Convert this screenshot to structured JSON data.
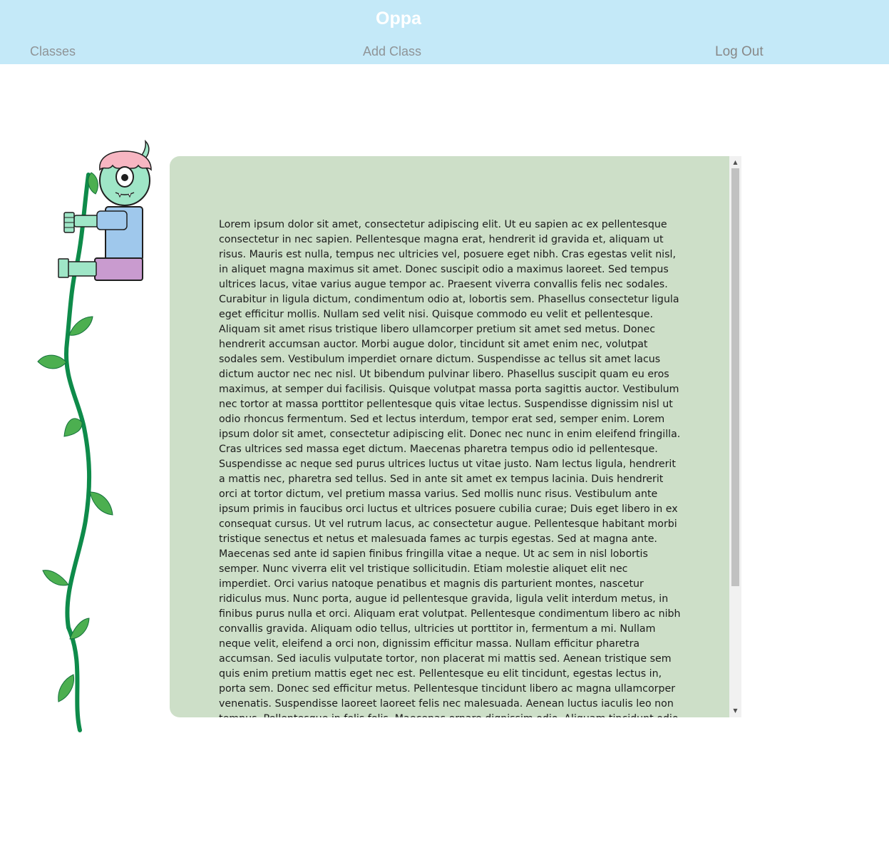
{
  "header": {
    "title": "Oppa",
    "nav": {
      "classes": "Classes",
      "add_class": "Add Class",
      "log_out": "Log Out"
    },
    "background_color": "#c4e9f8"
  },
  "illustration": {
    "icon": "monster-climbing-beanstalk-icon"
  },
  "content": {
    "panel_color": "#cddfc8",
    "body_text": "Lorem ipsum dolor sit amet, consectetur adipiscing elit. Ut eu sapien ac ex pellentesque consectetur in nec sapien. Pellentesque magna erat, hendrerit id gravida et, aliquam ut risus. Mauris est nulla, tempus nec ultricies vel, posuere eget nibh. Cras egestas velit nisl, in aliquet magna maximus sit amet. Donec suscipit odio a maximus laoreet. Sed tempus ultrices lacus, vitae varius augue tempor ac. Praesent viverra convallis felis nec sodales. Curabitur in ligula dictum, condimentum odio at, lobortis sem. Phasellus consectetur ligula eget efficitur mollis. Nullam sed velit nisi. Quisque commodo eu velit et pellentesque. Aliquam sit amet risus tristique libero ullamcorper pretium sit amet sed metus. Donec hendrerit accumsan auctor. Morbi augue dolor, tincidunt sit amet enim nec, volutpat sodales sem. Vestibulum imperdiet ornare dictum. Suspendisse ac tellus sit amet lacus dictum auctor nec nec nisl. Ut bibendum pulvinar libero. Phasellus suscipit quam eu eros maximus, at semper dui facilisis. Quisque volutpat massa porta sagittis auctor. Vestibulum nec tortor at massa porttitor pellentesque quis vitae lectus. Suspendisse dignissim nisl ut odio rhoncus fermentum. Sed et lectus interdum, tempor erat sed, semper enim. Lorem ipsum dolor sit amet, consectetur adipiscing elit. Donec nec nunc in enim eleifend fringilla. Cras ultrices sed massa eget dictum. Maecenas pharetra tempus odio id pellentesque. Suspendisse ac neque sed purus ultrices luctus ut vitae justo. Nam lectus ligula, hendrerit a mattis nec, pharetra sed tellus. Sed in ante sit amet ex tempus lacinia. Duis hendrerit orci at tortor dictum, vel pretium massa varius. Sed mollis nunc risus. Vestibulum ante ipsum primis in faucibus orci luctus et ultrices posuere cubilia curae; Duis eget libero in ex consequat cursus. Ut vel rutrum lacus, ac consectetur augue. Pellentesque habitant morbi tristique senectus et netus et malesuada fames ac turpis egestas. Sed at magna ante. Maecenas sed ante id sapien finibus fringilla vitae a neque. Ut ac sem in nisl lobortis semper. Nunc viverra elit vel tristique sollicitudin. Etiam molestie aliquet elit nec imperdiet. Orci varius natoque penatibus et magnis dis parturient montes, nascetur ridiculus mus. Nunc porta, augue id pellentesque gravida, ligula velit interdum metus, in finibus purus nulla et orci. Aliquam erat volutpat. Pellentesque condimentum libero ac nibh convallis gravida. Aliquam odio tellus, ultricies ut porttitor in, fermentum a mi. Nullam neque velit, eleifend a orci non, dignissim efficitur massa. Nullam efficitur pharetra accumsan. Sed iaculis vulputate tortor, non placerat mi mattis sed. Aenean tristique sem quis enim pretium mattis eget nec est. Pellentesque eu elit tincidunt, egestas lectus in, porta sem. Donec sed efficitur metus. Pellentesque tincidunt libero ac magna ullamcorper venenatis. Suspendisse laoreet laoreet felis nec malesuada. Aenean luctus iaculis leo non tempus. Pellentesque in felis felis. Maecenas ornare dignissim odio. Aliquam tincidunt odio at lorem convallis, id ornare nisi."
  }
}
